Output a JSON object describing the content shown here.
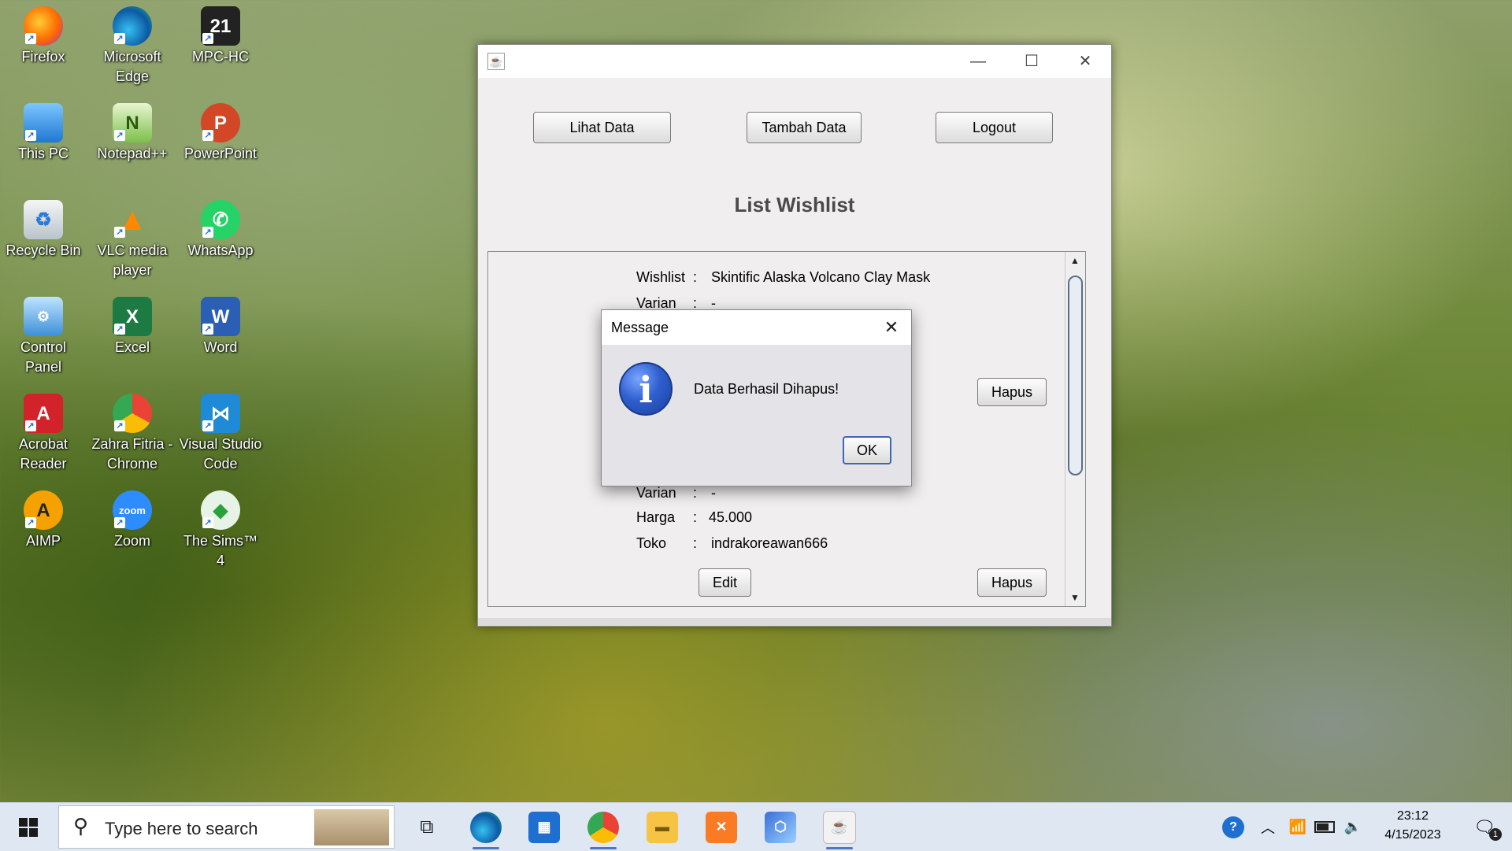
{
  "desktop": {
    "icons": [
      {
        "label": "Firefox"
      },
      {
        "label": "Microsoft Edge"
      },
      {
        "label": "MPC-HC"
      },
      {
        "label": "This PC"
      },
      {
        "label": "Notepad++"
      },
      {
        "label": "PowerPoint"
      },
      {
        "label": "Recycle Bin"
      },
      {
        "label": "VLC media player"
      },
      {
        "label": "WhatsApp"
      },
      {
        "label": "Control Panel"
      },
      {
        "label": "Excel"
      },
      {
        "label": "Word"
      },
      {
        "label": "Acrobat Reader"
      },
      {
        "label": "Zahra Fitria - Chrome"
      },
      {
        "label": "Visual Studio Code"
      },
      {
        "label": "AIMP"
      },
      {
        "label": "Zoom"
      },
      {
        "label": "The Sims™ 4"
      }
    ]
  },
  "app": {
    "buttons": {
      "lihat_data": "Lihat Data",
      "tambah_data": "Tambah Data",
      "logout": "Logout"
    },
    "list_title": "List Wishlist",
    "items": [
      {
        "wishlist_label": "Wishlist",
        "wishlist_value": "Skintific Alaska Volcano Clay Mask",
        "varian_label": "Varian",
        "varian_value": "-",
        "hapus": "Hapus"
      },
      {
        "varian_label": "Varian",
        "varian_value": "-",
        "harga_label": "Harga",
        "harga_value": "45.000",
        "toko_label": "Toko",
        "toko_value": "indrakoreawan666",
        "edit": "Edit",
        "hapus": "Hapus"
      }
    ],
    "colon": ":"
  },
  "dialog": {
    "title": "Message",
    "message": "Data Berhasil Dihapus!",
    "ok": "OK"
  },
  "taskbar": {
    "search_placeholder": "Type here to search",
    "time": "23:12",
    "date": "4/15/2023",
    "notification_count": "1"
  }
}
